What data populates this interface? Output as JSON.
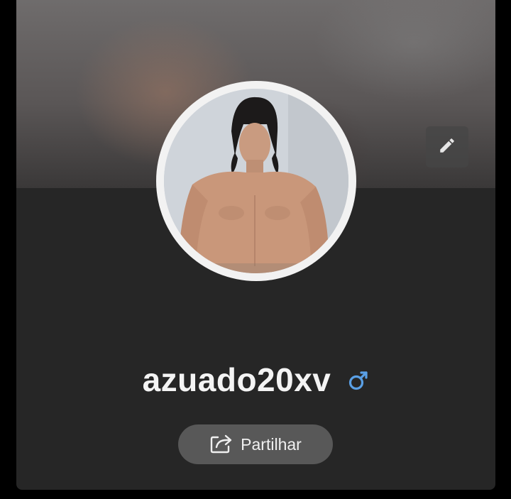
{
  "profile": {
    "username": "azuado20xv",
    "gender_icon": "male-symbol-icon",
    "share_label": "Partilhar",
    "edit_icon": "pencil-icon",
    "share_icon": "share-arrow-icon"
  },
  "colors": {
    "card_background": "#262626",
    "page_background": "#000000",
    "gender_accent": "#5aa0e6",
    "share_button": "#585858",
    "avatar_ring": "#f2f2f2"
  }
}
